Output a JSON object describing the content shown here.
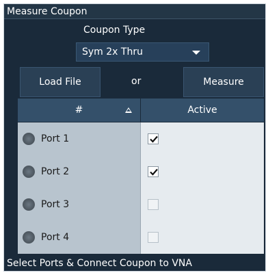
{
  "panel": {
    "title": "Measure Coupon"
  },
  "coupon_type": {
    "label": "Coupon Type",
    "selected": "Sym 2x Thru"
  },
  "buttons": {
    "load_file": "Load File",
    "or": "or",
    "measure": "Measure"
  },
  "table": {
    "headers": {
      "number": "#",
      "active": "Active"
    },
    "rows": [
      {
        "port": "Port 1",
        "active": true
      },
      {
        "port": "Port 2",
        "active": true
      },
      {
        "port": "Port 3",
        "active": false
      },
      {
        "port": "Port 4",
        "active": false
      }
    ]
  },
  "footer": {
    "status": "Select Ports & Connect Coupon to VNA"
  },
  "colors": {
    "panel_bg": "#1a2a3a",
    "header_bg": "#34506a",
    "port_cell_bg": "#b8c4ce",
    "active_cell_bg": "#e6ebef"
  },
  "icons": {
    "dropdown": "chevron-down-icon",
    "sort": "sort-ascending-icon",
    "port": "port-status-icon",
    "check": "checkmark-icon"
  }
}
